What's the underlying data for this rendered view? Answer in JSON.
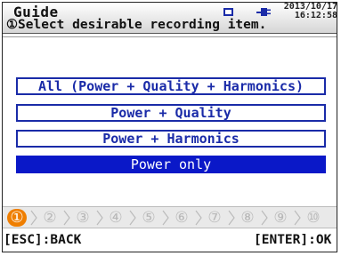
{
  "header": {
    "title": "Guide",
    "instruction": "①Select desirable recording item.",
    "date": "2013/10/17",
    "time": "16:12:58"
  },
  "options": [
    {
      "label": "All (Power + Quality + Harmonics)",
      "selected": false
    },
    {
      "label": "Power + Quality",
      "selected": false
    },
    {
      "label": "Power + Harmonics",
      "selected": false
    },
    {
      "label": "Power only",
      "selected": true
    }
  ],
  "steps": [
    "①",
    "②",
    "③",
    "④",
    "⑤",
    "⑥",
    "⑦",
    "⑧",
    "⑨",
    "⑩"
  ],
  "active_step": 1,
  "footer": {
    "back": "[ESC]:BACK",
    "ok": "[ENTER]:OK"
  },
  "colors": {
    "accent": "#1a2ba8",
    "selected_bg": "#0a18c8",
    "active_step": "#ef7e00",
    "inactive_step": "#b8b8b8"
  },
  "icons": {
    "sd_card": "sd-card-icon",
    "power": "power-plug-icon"
  }
}
